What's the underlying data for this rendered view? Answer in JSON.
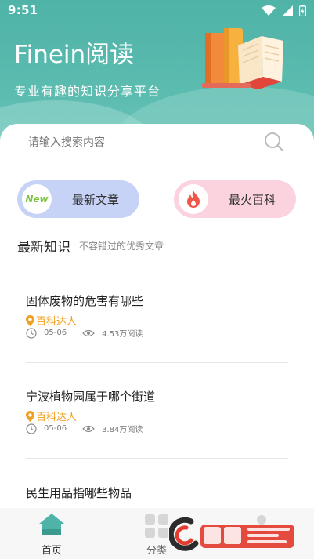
{
  "status_bar": {
    "time": "9:51"
  },
  "app": {
    "name": "Finein阅读",
    "slogan": "专业有趣的知识分享平台"
  },
  "search": {
    "placeholder": "请输入搜索内容"
  },
  "buttons": {
    "latest": {
      "label": "最新文章",
      "badge": "New"
    },
    "hot": {
      "label": "最火百科"
    }
  },
  "section": {
    "title": "最新知识",
    "subtitle": "不容错过的优秀文章"
  },
  "articles": [
    {
      "title": "固体废物的危害有哪些",
      "author": "百科达人",
      "date": "05-06",
      "views": "4.53万阅读"
    },
    {
      "title": "宁波植物园属于哪个街道",
      "author": "百科达人",
      "date": "05-06",
      "views": "3.84万阅读"
    },
    {
      "title": "民生用品指哪些物品",
      "author": "",
      "date": "",
      "views": ""
    }
  ],
  "tabs": [
    {
      "label": "首页",
      "icon": "home-icon",
      "active": true
    },
    {
      "label": "分类",
      "icon": "grid-icon",
      "active": false
    },
    {
      "label": "",
      "icon": "profile-icon",
      "active": false
    }
  ],
  "colors": {
    "header": "#55b6aa",
    "accent": "#4fb3a8",
    "author": "#f0a020",
    "pill_new": "#c6d3f7",
    "pill_hot": "#fbd3de"
  }
}
